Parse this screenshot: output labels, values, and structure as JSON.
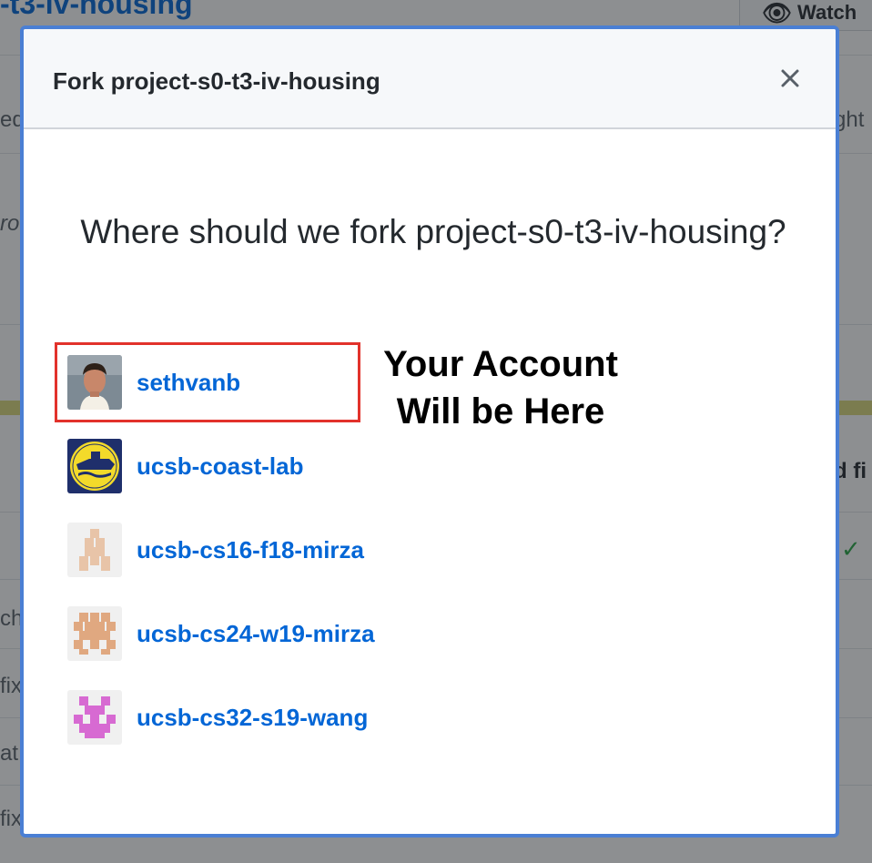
{
  "background": {
    "repo_title": "-t3-iv-housing",
    "watch_label": "Watch",
    "fragments": {
      "left_1": "eq",
      "left_2": "ro",
      "left_3": "ch",
      "left_4": "fix",
      "left_5": "at",
      "left_6": "fix",
      "right_1": "ght",
      "right_2": "d fi"
    }
  },
  "modal": {
    "title": "Fork project-s0-t3-iv-housing",
    "question": "Where should we fork project-s0-t3-iv-housing?",
    "accounts": [
      {
        "name": "sethvanb",
        "avatar": "photo"
      },
      {
        "name": "ucsb-coast-lab",
        "avatar": "seal"
      },
      {
        "name": "ucsb-cs16-f18-mirza",
        "avatar": "identicon",
        "color": "#e8c4a8"
      },
      {
        "name": "ucsb-cs24-w19-mirza",
        "avatar": "identicon",
        "color": "#e0a880"
      },
      {
        "name": "ucsb-cs32-s19-wang",
        "avatar": "identicon",
        "color": "#d76ad2"
      }
    ],
    "annotation": {
      "line1": "Your Account",
      "line2": "Will be Here"
    }
  },
  "colors": {
    "link": "#0366d6",
    "highlight": "#e2322b",
    "modal_border": "#4a7fd4"
  },
  "icons": [
    "close-icon",
    "eye-icon",
    "check-icon"
  ]
}
